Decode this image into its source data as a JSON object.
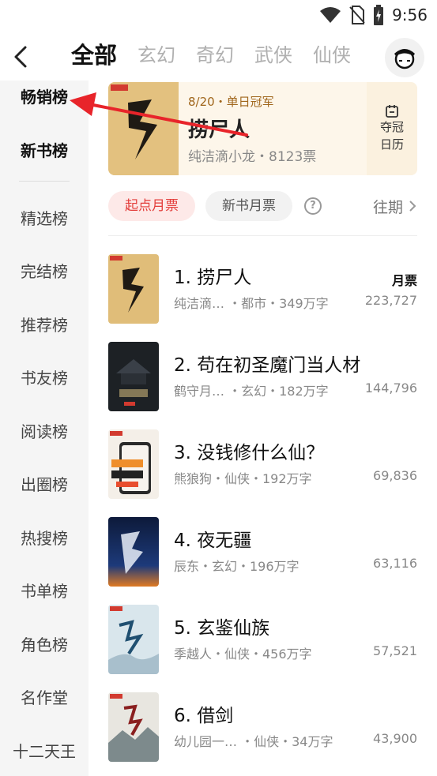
{
  "status": {
    "time": "9:56"
  },
  "nav": {
    "tabs": [
      {
        "label": "全部",
        "active": true
      },
      {
        "label": "玄幻"
      },
      {
        "label": "奇幻"
      },
      {
        "label": "武侠"
      },
      {
        "label": "仙侠"
      }
    ]
  },
  "sidebar": {
    "items": [
      {
        "label": "畅销榜",
        "active": true
      },
      {
        "label": "新书榜"
      },
      {
        "label": "精选榜"
      },
      {
        "label": "完结榜"
      },
      {
        "label": "推荐榜"
      },
      {
        "label": "书友榜"
      },
      {
        "label": "阅读榜"
      },
      {
        "label": "出圈榜"
      },
      {
        "label": "热搜榜"
      },
      {
        "label": "书单榜"
      },
      {
        "label": "角色榜"
      },
      {
        "label": "名作堂"
      },
      {
        "label": "十二天王"
      }
    ]
  },
  "champion": {
    "badge": "8/20・单日冠军",
    "title": "捞尸人",
    "meta": "纯洁滴小龙・8123票",
    "calendar_line1": "夺冠",
    "calendar_line2": "日历"
  },
  "filters": {
    "active": "起点月票",
    "inactive": "新书月票",
    "help": "?",
    "past": "往期"
  },
  "list": {
    "column_header": "月票",
    "rows": [
      {
        "title": "1. 捞尸人",
        "meta": "纯洁滴… ・都市・349万字",
        "votes": "223,727"
      },
      {
        "title": "2. 苟在初圣魔门当人材",
        "meta": "鹤守月… ・玄幻・182万字",
        "votes": "144,796"
      },
      {
        "title": "3. 没钱修什么仙？",
        "meta": "熊狼狗・仙侠・192万字",
        "votes": "69,836"
      },
      {
        "title": "4. 夜无疆",
        "meta": "辰东・玄幻・196万字",
        "votes": "63,116"
      },
      {
        "title": "5. 玄鉴仙族",
        "meta": "季越人・仙侠・456万字",
        "votes": "57,521"
      },
      {
        "title": "6. 借剑",
        "meta": "幼儿园一… ・仙侠・34万字",
        "votes": "43,900"
      }
    ]
  },
  "colors": {
    "accent": "#e33d3a",
    "annotation_arrow": "#e8242a",
    "sidebar_bg": "#f5f5f5",
    "champion_bg": "#fdf6ea"
  },
  "icons": [
    "wifi-icon",
    "no-sim-icon",
    "battery-charging-icon",
    "back-arrow-icon",
    "avatar-icon",
    "calendar-icon",
    "help-icon",
    "chevron-right-icon"
  ]
}
